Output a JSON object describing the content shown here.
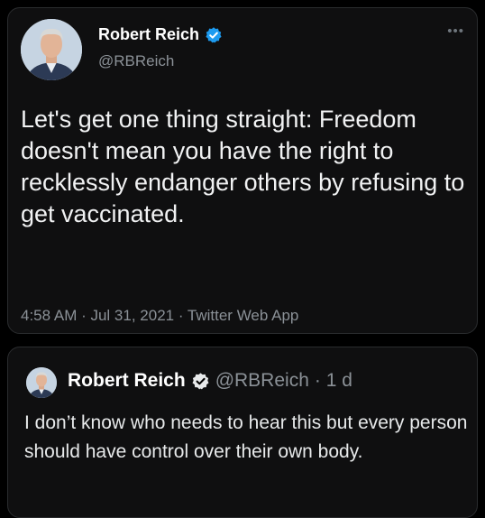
{
  "tweet": {
    "author_name": "Robert Reich",
    "author_handle": "@RBReich",
    "more_icon": "more-horizontal-icon",
    "verified_icon": "verified-badge-icon",
    "text": "Let's get one thing straight: Freedom doesn't mean you have the right to recklessly endanger others by refusing to get vaccinated.",
    "meta": "4:58 AM · Jul 31, 2021 · Twitter Web App"
  },
  "quoted": {
    "author_name": "Robert Reich",
    "author_handle": "@RBReich",
    "age": "· 1 d",
    "verified_icon": "verified-badge-icon",
    "text": "I don’t know who needs to hear this but every person should have control over their own body."
  },
  "colors": {
    "background": "#000000",
    "card": "#0f0f10",
    "verified_blue": "#1d9bf0",
    "secondary_text": "#8b9197"
  }
}
